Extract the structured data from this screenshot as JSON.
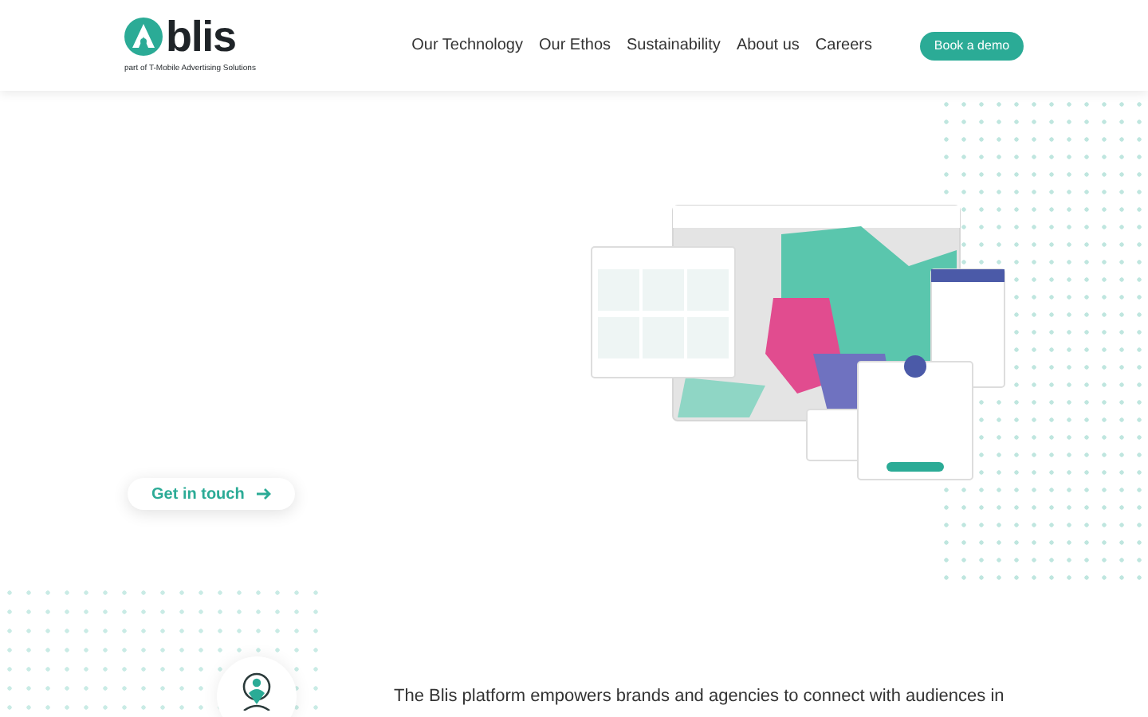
{
  "header": {
    "logo": {
      "wordmark": "blis",
      "tagline": "part of T-Mobile Advertising Solutions"
    },
    "nav": [
      "Our Technology",
      "Our Ethos",
      "Sustainability",
      "About us",
      "Careers"
    ],
    "cta": "Book a demo"
  },
  "hero": {
    "button": "Get in touch"
  },
  "intro": {
    "text": "The Blis platform empowers brands and agencies to connect with audiences in"
  }
}
